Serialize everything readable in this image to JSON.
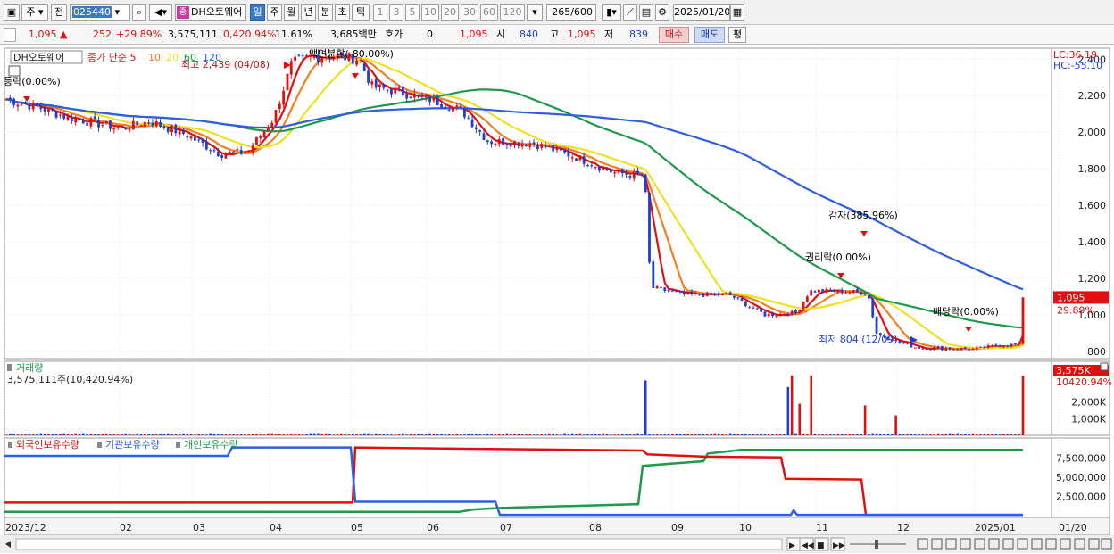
{
  "toolbar": {
    "market": "주",
    "prev": "전",
    "code": "025440",
    "name": "DH오토웨어",
    "name_badge": "종",
    "periods": [
      "일",
      "주",
      "월",
      "년",
      "분",
      "초",
      "틱"
    ],
    "intervals": [
      "1",
      "3",
      "5",
      "10",
      "20",
      "30",
      "60",
      "120"
    ],
    "count": "265",
    "count_total": "/600",
    "date": "2025/01/20"
  },
  "quote": {
    "price": "1,095",
    "change": "252",
    "change_rate": "+29.89%",
    "volume": "3,575,111",
    "volume_rate": "0,420.94%",
    "turnover": "11.61%",
    "amount": "3,685백만",
    "hoga_label": "호가",
    "hoga": "0",
    "hoga_price": "1,095",
    "open_label": "시",
    "open": "840",
    "high_label": "고",
    "high": "1,095",
    "low_label": "저",
    "low": "839",
    "buy_label": "매수",
    "sell_label": "매도",
    "eval_label": "평"
  },
  "price_panel": {
    "legend_name": "DH오토웨어",
    "legend_ma_label": "종가 단순",
    "legend_ma": [
      {
        "period": "5",
        "color": "#e01010"
      },
      {
        "period": "10",
        "color": "#f08020"
      },
      {
        "period": "20",
        "color": "#f0e020"
      },
      {
        "period": "60",
        "color": "#1f9a4a"
      },
      {
        "period": "120",
        "color": "#2f5fe0"
      }
    ],
    "lc": "LC:36.19",
    "hc": "HC:-55.10",
    "current_tag": "1,095",
    "current_rate": "29.89%",
    "y_ticks": [
      "2,400",
      "2,200",
      "2,000",
      "1,800",
      "1,600",
      "1,400",
      "1,200",
      "1,000",
      "800"
    ],
    "annotations": [
      {
        "text": "등락(0.00%)",
        "color": "#000000"
      },
      {
        "text": "최고 2,439 (04/08)",
        "color": "#c81010"
      },
      {
        "text": "액면분할(-80.00%)",
        "color": "#000000"
      },
      {
        "text": "감자(385.96%)",
        "color": "#000000"
      },
      {
        "text": "권리락(0.00%)",
        "color": "#000000"
      },
      {
        "text": "배당락(0.00%)",
        "color": "#000000"
      },
      {
        "text": "최저 804 (12/09)",
        "color": "#1f3fd0"
      }
    ]
  },
  "volume_panel": {
    "title": "거래량",
    "summary": "3,575,111주(10,420.94%)",
    "current_tag": "3,575K",
    "current_rate": "10420.94%",
    "y_ticks": [
      "2,000K",
      "1,000K"
    ]
  },
  "holding_panel": {
    "series": [
      {
        "label": "외국인보유수량",
        "color": "#e01010"
      },
      {
        "label": "기관보유수량",
        "color": "#2f5fe0"
      },
      {
        "label": "개인보유수량",
        "color": "#1f9a4a"
      }
    ],
    "y_ticks": [
      "7,500,000",
      "5,000,000",
      "2,500,000"
    ]
  },
  "x_axis": {
    "labels": [
      "2023/12",
      "02",
      "03",
      "04",
      "05",
      "06",
      "07",
      "08",
      "09",
      "10",
      "11",
      "12",
      "2025/01",
      "01/20"
    ]
  },
  "chart_data": {
    "type": "candlestick",
    "x_range": [
      "2023/12",
      "2025/01/20"
    ],
    "price_ylim": [
      760,
      2460
    ],
    "price_line_approx": [
      {
        "date": "2023/12",
        "value": 2180
      },
      {
        "date": "02",
        "value": 2060
      },
      {
        "date": "03",
        "value": 1900
      },
      {
        "date": "03 end",
        "value": 1880
      },
      {
        "date": "04/08",
        "value": 2439
      },
      {
        "date": "05",
        "value": 2250
      },
      {
        "date": "06",
        "value": 2150
      },
      {
        "date": "07",
        "value": 1950
      },
      {
        "date": "08",
        "value": 1800
      },
      {
        "date": "08 end",
        "value": 1150
      },
      {
        "date": "09",
        "value": 1110
      },
      {
        "date": "10",
        "value": 1010
      },
      {
        "date": "11",
        "value": 1130
      },
      {
        "date": "12/09",
        "value": 804
      },
      {
        "date": "2025/01",
        "value": 840
      },
      {
        "date": "01/20",
        "value": 1095
      }
    ],
    "last": {
      "date": "2025/01/20",
      "open": 840,
      "high": 1095,
      "low": 839,
      "close": 1095,
      "volume": 3575111
    }
  },
  "bottom": {
    "nav_buttons": [
      "▶",
      "◀◀",
      "■",
      "▶▶"
    ]
  }
}
